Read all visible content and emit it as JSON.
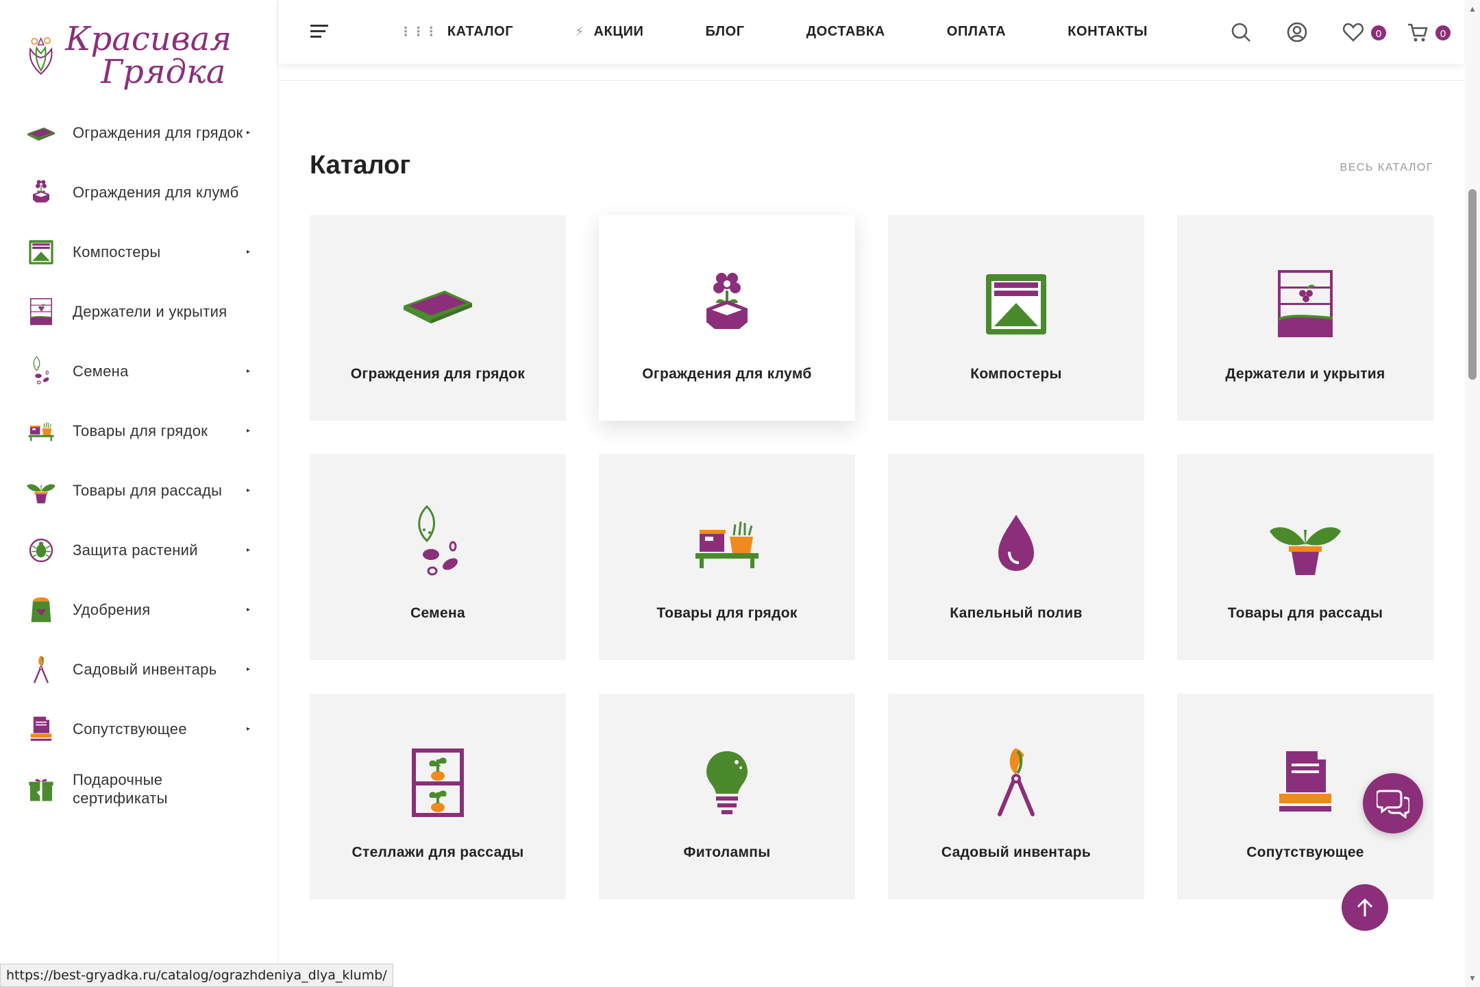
{
  "colors": {
    "accent": "#8b2f7a",
    "green": "#4a8a2c",
    "orange": "#f08a1c",
    "card_bg": "#f3f3f3"
  },
  "logo": {
    "line1": "Красивая",
    "line2": "Грядка"
  },
  "sidebar": {
    "items": [
      {
        "label": "Ограждения для грядок",
        "icon": "raised-bed-icon",
        "has_submenu": true
      },
      {
        "label": "Ограждения для клумб",
        "icon": "flowerbed-icon",
        "has_submenu": false
      },
      {
        "label": "Компостеры",
        "icon": "composter-icon",
        "has_submenu": true
      },
      {
        "label": "Держатели и укрытия",
        "icon": "trellis-icon",
        "has_submenu": false
      },
      {
        "label": "Семена",
        "icon": "seeds-icon",
        "has_submenu": true
      },
      {
        "label": "Товары для грядок",
        "icon": "garden-bench-icon",
        "has_submenu": true
      },
      {
        "label": "Товары для рассады",
        "icon": "seedling-icon",
        "has_submenu": true
      },
      {
        "label": "Защита растений",
        "icon": "bug-icon",
        "has_submenu": true
      },
      {
        "label": "Удобрения",
        "icon": "fertilizer-icon",
        "has_submenu": true
      },
      {
        "label": "Садовый инвентарь",
        "icon": "pruner-icon",
        "has_submenu": true
      },
      {
        "label": "Сопутствующее",
        "icon": "documents-icon",
        "has_submenu": true
      },
      {
        "label": "Подарочные сертификаты",
        "icon": "gift-icon",
        "has_submenu": false
      }
    ]
  },
  "header": {
    "nav": [
      {
        "label": "КАТАЛОГ",
        "icon": "grid-dots-icon"
      },
      {
        "label": "АКЦИИ",
        "icon": "lightning-icon"
      },
      {
        "label": "БЛОГ",
        "icon": ""
      },
      {
        "label": "ДОСТАВКА",
        "icon": ""
      },
      {
        "label": "ОПЛАТА",
        "icon": ""
      },
      {
        "label": "КОНТАКТЫ",
        "icon": ""
      }
    ],
    "wishlist_count": "0",
    "cart_count": "0"
  },
  "main": {
    "title": "Каталог",
    "all_link": "ВЕСЬ КАТАЛОГ",
    "cards": [
      {
        "label": "Ограждения для грядок",
        "icon": "raised-bed-icon"
      },
      {
        "label": "Ограждения для клумб",
        "icon": "flowerbed-icon",
        "hovered": true
      },
      {
        "label": "Компостеры",
        "icon": "composter-icon"
      },
      {
        "label": "Держатели и укрытия",
        "icon": "trellis-icon"
      },
      {
        "label": "Семена",
        "icon": "seeds-icon"
      },
      {
        "label": "Товары для грядок",
        "icon": "garden-bench-icon"
      },
      {
        "label": "Капельный полив",
        "icon": "water-drop-icon"
      },
      {
        "label": "Товары для рассады",
        "icon": "seedling-icon"
      },
      {
        "label": "Стеллажи для рассады",
        "icon": "shelf-icon"
      },
      {
        "label": "Фитолампы",
        "icon": "lightbulb-icon"
      },
      {
        "label": "Садовый инвентарь",
        "icon": "pruner-icon"
      },
      {
        "label": "Сопутствующее",
        "icon": "documents-icon"
      }
    ]
  },
  "status_bar": {
    "url": "https://best-gryadka.ru/catalog/ograzhdeniya_dlya_klumb/"
  }
}
